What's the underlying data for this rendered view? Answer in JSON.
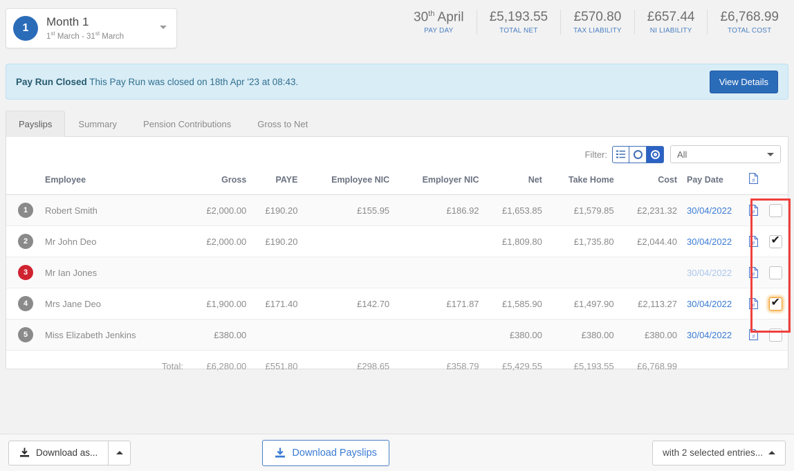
{
  "period": {
    "badge": "1",
    "title": "Month 1",
    "range_start_num": "1",
    "range_start_sup": "st",
    "range_mid": " March - 31",
    "range_end_sup": "st",
    "range_tail": " March"
  },
  "stats": [
    {
      "value": "30",
      "sup": "th",
      "value_tail": " April",
      "label": "PAY DAY"
    },
    {
      "value": "£5,193.55",
      "sup": "",
      "value_tail": "",
      "label": "TOTAL NET"
    },
    {
      "value": "£570.80",
      "sup": "",
      "value_tail": "",
      "label": "TAX LIABILITY"
    },
    {
      "value": "£657.44",
      "sup": "",
      "value_tail": "",
      "label": "NI LIABILITY"
    },
    {
      "value": "£6,768.99",
      "sup": "",
      "value_tail": "",
      "label": "TOTAL COST"
    }
  ],
  "alert": {
    "title": "Pay Run Closed",
    "message": " This Pay Run was closed on 18th Apr '23 at 08:43.",
    "button": "View Details"
  },
  "tabs": [
    {
      "label": "Payslips",
      "active": true
    },
    {
      "label": "Summary",
      "active": false
    },
    {
      "label": "Pension Contributions",
      "active": false
    },
    {
      "label": "Gross to Net",
      "active": false
    }
  ],
  "filter": {
    "label": "Filter:",
    "buttons": [
      {
        "icon": "list-icon",
        "active": false
      },
      {
        "icon": "circle-outline-icon",
        "active": false
      },
      {
        "icon": "circle-selected-icon",
        "active": true
      }
    ],
    "select_value": "All"
  },
  "table": {
    "columns": [
      "Employee",
      "Gross",
      "PAYE",
      "Employee NIC",
      "Employer NIC",
      "Net",
      "Take Home",
      "Cost",
      "Pay Date"
    ],
    "pdf_column_icon": "pdf-icon",
    "rows": [
      {
        "index": "1",
        "index_state": "normal",
        "name": "Robert Smith",
        "gross": "£2,000.00",
        "paye": "£190.20",
        "employee_nic": "£155.95",
        "employer_nic": "£186.92",
        "net": "£1,653.85",
        "take_home": "£1,579.85",
        "cost": "£2,231.32",
        "pay_date": "30/04/2022",
        "pay_date_muted": false,
        "checked": false,
        "focused": false
      },
      {
        "index": "2",
        "index_state": "normal",
        "name": "Mr John Deo",
        "gross": "£2,000.00",
        "paye": "£190.20",
        "employee_nic": "",
        "employer_nic": "",
        "net": "£1,809.80",
        "take_home": "£1,735.80",
        "cost": "£2,044.40",
        "pay_date": "30/04/2022",
        "pay_date_muted": false,
        "checked": true,
        "focused": false
      },
      {
        "index": "3",
        "index_state": "error",
        "name": "Mr Ian Jones",
        "gross": "",
        "paye": "",
        "employee_nic": "",
        "employer_nic": "",
        "net": "",
        "take_home": "",
        "cost": "",
        "pay_date": "30/04/2022",
        "pay_date_muted": true,
        "checked": false,
        "focused": false
      },
      {
        "index": "4",
        "index_state": "normal",
        "name": "Mrs Jane Deo",
        "gross": "£1,900.00",
        "paye": "£171.40",
        "employee_nic": "£142.70",
        "employer_nic": "£171.87",
        "net": "£1,585.90",
        "take_home": "£1,497.90",
        "cost": "£2,113.27",
        "pay_date": "30/04/2022",
        "pay_date_muted": false,
        "checked": true,
        "focused": true
      },
      {
        "index": "5",
        "index_state": "normal",
        "name": "Miss Elizabeth Jenkins",
        "gross": "£380.00",
        "paye": "",
        "employee_nic": "",
        "employer_nic": "",
        "net": "£380.00",
        "take_home": "£380.00",
        "cost": "£380.00",
        "pay_date": "30/04/2022",
        "pay_date_muted": false,
        "checked": false,
        "focused": false
      }
    ],
    "totals": {
      "label": "Total:",
      "gross": "£6,280.00",
      "paye": "£551.80",
      "employee_nic": "£298.65",
      "employer_nic": "£358.79",
      "net": "£5,429.55",
      "take_home": "£5,193.55",
      "cost": "£6,768.99"
    }
  },
  "footer": {
    "download_as": "Download as...",
    "download_payslips": "Download Payslips",
    "with_selected": "with 2 selected entries..."
  },
  "colors": {
    "accent_blue": "#2b6cb9",
    "link_blue": "#3a7bd5",
    "alert_bg": "#d9edf7",
    "alert_text": "#31708f",
    "badge_gray": "#8a8a8a",
    "badge_error": "#cf2330",
    "focus_orange": "#f0a030",
    "annotation_red": "#f0403c"
  }
}
